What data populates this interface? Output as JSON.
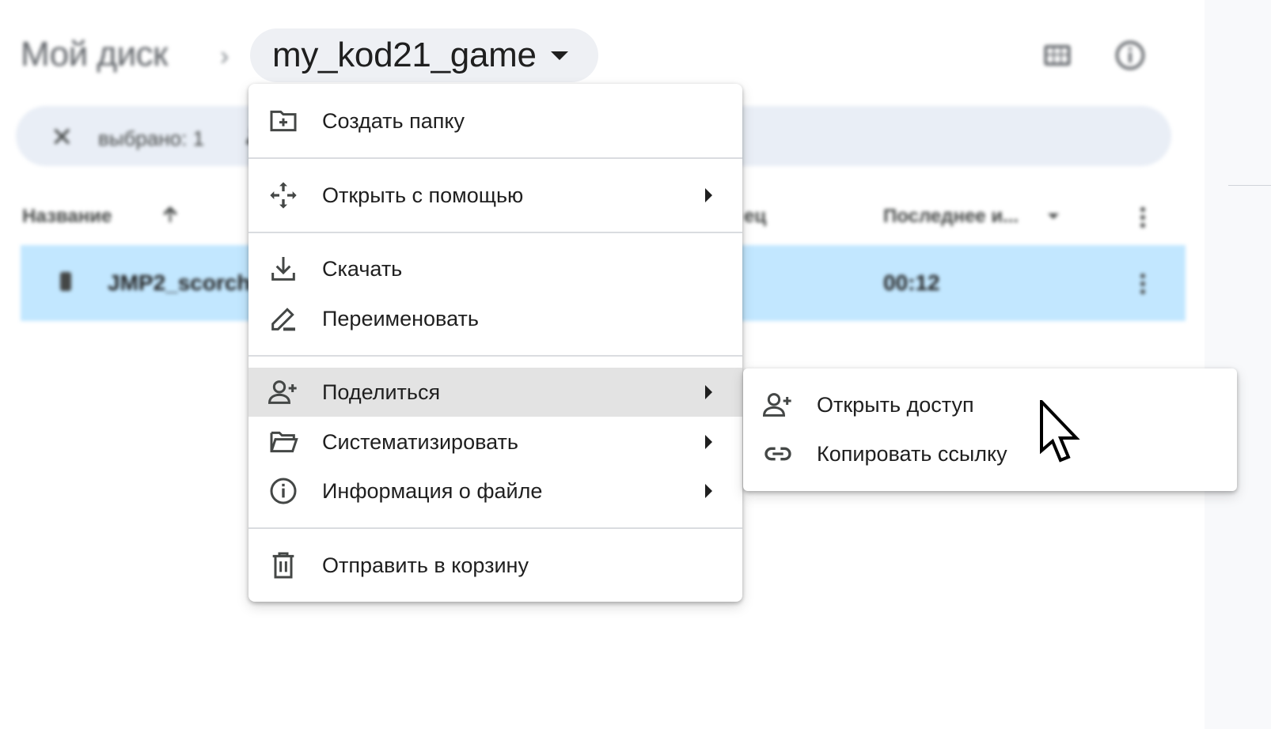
{
  "header": {
    "root_label": "Мой диск",
    "separator": "›",
    "current_folder": "my_kod21_game"
  },
  "selection_bar": {
    "close_glyph": "✕",
    "count_label": "выбрано: 1"
  },
  "columns": {
    "name": "Название",
    "owner_partial": "ец",
    "modified": "Последнее и..."
  },
  "file_row": {
    "name": "JMP2_scorch",
    "time": "00:12"
  },
  "context_menu": {
    "items": [
      {
        "label": "Создать папку",
        "icon": "create-folder-icon",
        "submenu": false
      },
      {
        "label": "Открыть с помощью",
        "icon": "open-with-icon",
        "submenu": true
      },
      {
        "label": "Скачать",
        "icon": "download-icon",
        "submenu": false
      },
      {
        "label": "Переименовать",
        "icon": "rename-icon",
        "submenu": false
      },
      {
        "label": "Поделиться",
        "icon": "share-icon",
        "submenu": true,
        "highlighted": true
      },
      {
        "label": "Систематизировать",
        "icon": "organize-icon",
        "submenu": true
      },
      {
        "label": "Информация о файле",
        "icon": "info-icon",
        "submenu": true
      },
      {
        "label": "Отправить в корзину",
        "icon": "trash-icon",
        "submenu": false
      }
    ]
  },
  "share_submenu": {
    "items": [
      {
        "label": "Открыть доступ",
        "icon": "person-add-icon"
      },
      {
        "label": "Копировать ссылку",
        "icon": "link-icon"
      }
    ]
  },
  "colors": {
    "selected_row": "#c2e7ff",
    "selection_bar": "#e9eef6",
    "menu_highlight": "#e3e3e3",
    "text": "#1f1f1f"
  }
}
